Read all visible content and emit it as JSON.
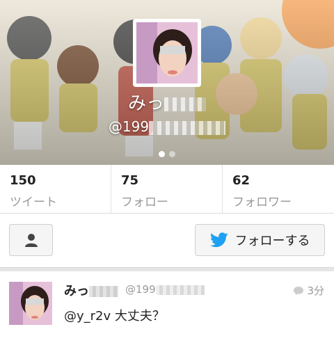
{
  "profile": {
    "display_name": "みっ",
    "handle": "@199"
  },
  "stats": [
    {
      "value": "150",
      "label": "ツイート"
    },
    {
      "value": "75",
      "label": "フォロー"
    },
    {
      "value": "62",
      "label": "フォロワー"
    }
  ],
  "actions": {
    "follow_label": "フォローする"
  },
  "tweet": {
    "author_name": "みっ",
    "author_handle": "@199",
    "time": "3分",
    "mention": "@y_r2v",
    "text": "大丈夫？"
  },
  "colors": {
    "twitter_blue": "#1da1f2",
    "banner_accent": "#f39a4a"
  },
  "icons": [
    "user-icon",
    "twitter-bird-icon",
    "speech-bubble-icon"
  ]
}
